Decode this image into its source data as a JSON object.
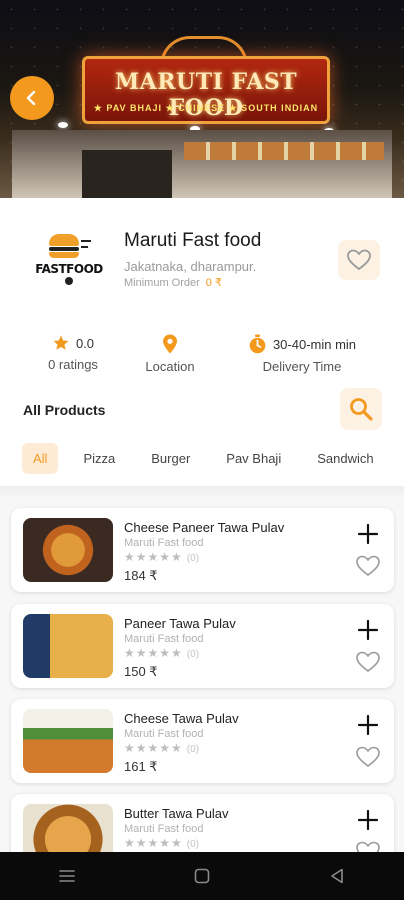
{
  "banner": {
    "sign_title": "MARUTI FAST FOOD",
    "sign_subtitle": "★ PAV BHAJI ★ CHINESE ★ SOUTH INDIAN"
  },
  "restaurant": {
    "logo_text": "FASTFOOD",
    "name": "Maruti Fast food",
    "address": "Jakatnaka, dharampur.",
    "min_order_label": "Minimum Order",
    "min_order_value": "0 ₹"
  },
  "stats": {
    "rating_value": "0.0",
    "rating_label": "0 ratings",
    "location_label": "Location",
    "delivery_value": "30-40-min min",
    "delivery_label": "Delivery Time"
  },
  "products_header": "All Products",
  "categories": [
    "All",
    "Pizza",
    "Burger",
    "Pav Bhaji",
    "Sandwich"
  ],
  "products": [
    {
      "name": "Cheese Paneer Tawa Pulav",
      "shop": "Maruti Fast food",
      "stars": "★★★★★",
      "rating_count": "(0)",
      "price": "184 ₹"
    },
    {
      "name": "Paneer Tawa Pulav",
      "shop": "Maruti Fast food",
      "stars": "★★★★★",
      "rating_count": "(0)",
      "price": "150 ₹"
    },
    {
      "name": "Cheese Tawa Pulav",
      "shop": "Maruti Fast food",
      "stars": "★★★★★",
      "rating_count": "(0)",
      "price": "161 ₹"
    },
    {
      "name": "Butter Tawa Pulav",
      "shop": "Maruti Fast food",
      "stars": "★★★★★",
      "rating_count": "(0)",
      "price": ""
    }
  ],
  "colors": {
    "accent": "#f39a1e",
    "accent_soft": "#fdf1e3",
    "muted_text": "#9a9a9a"
  },
  "icons": {
    "back": "chevron-left-icon",
    "favorite": "heart-icon",
    "rating": "star-icon",
    "location": "map-pin-icon",
    "delivery": "timer-icon",
    "search": "search-icon",
    "add": "plus-icon"
  }
}
